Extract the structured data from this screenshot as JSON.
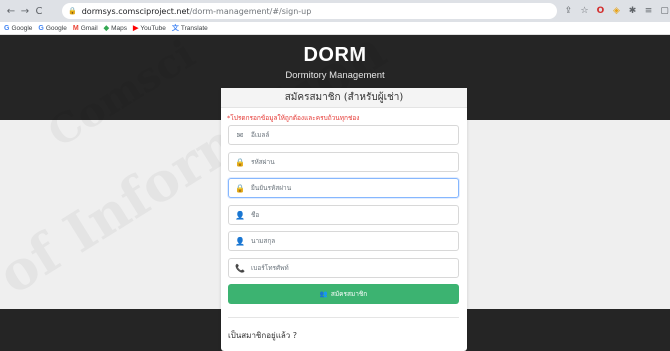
{
  "browser": {
    "url_host": "dormsys.comsciproject.net",
    "url_path": "/dorm-management/#/sign-up",
    "nav": [
      "←",
      "→",
      "C"
    ],
    "toolbar_icons": [
      "share-icon",
      "star-icon",
      "opera-icon",
      "extension-icon",
      "puzzle-icon",
      "reading-list-icon",
      "sidebar-icon",
      "profile-avatar"
    ]
  },
  "bookmarks": [
    {
      "icon": "G",
      "label": "Google",
      "color": "#4285f4"
    },
    {
      "icon": "G",
      "label": "Google",
      "color": "#4285f4"
    },
    {
      "icon": "M",
      "label": "Gmail",
      "color": "#ea4335"
    },
    {
      "icon": "◆",
      "label": "Maps",
      "color": "#34a853"
    },
    {
      "icon": "▶",
      "label": "YouTube",
      "color": "#ff0000"
    },
    {
      "icon": "文",
      "label": "Translate",
      "color": "#4285f4"
    }
  ],
  "hero": {
    "title": "DORM",
    "subtitle": "Dormitory Management"
  },
  "card": {
    "header": "สมัครสมาชิก (สำหรับผู้เช่า)",
    "warning": "*โปรดกรอกข้อมูลให้ถูกต้องและครบถ้วนทุกช่อง",
    "fields": [
      {
        "icon": "✉",
        "placeholder": "อีเมลล์"
      },
      {
        "icon": "🔒",
        "placeholder": "รหัสผ่าน"
      },
      {
        "icon": "🔒",
        "placeholder": "ยืนยันรหัสผ่าน"
      },
      {
        "icon": "👤",
        "placeholder": "ชื่อ"
      },
      {
        "icon": "👤",
        "placeholder": "นามสกุล"
      },
      {
        "icon": "📞",
        "placeholder": "เบอร์โทรศัพท์"
      }
    ],
    "signup_button": "สมัครสมาชิก",
    "signup_icon": "add-user-icon",
    "already_member": "เป็นสมาชิกอยู่แล้ว ?"
  },
  "colors": {
    "dark_bg": "#252525",
    "primary_green": "#3cb371",
    "warning_red": "#e53935"
  }
}
